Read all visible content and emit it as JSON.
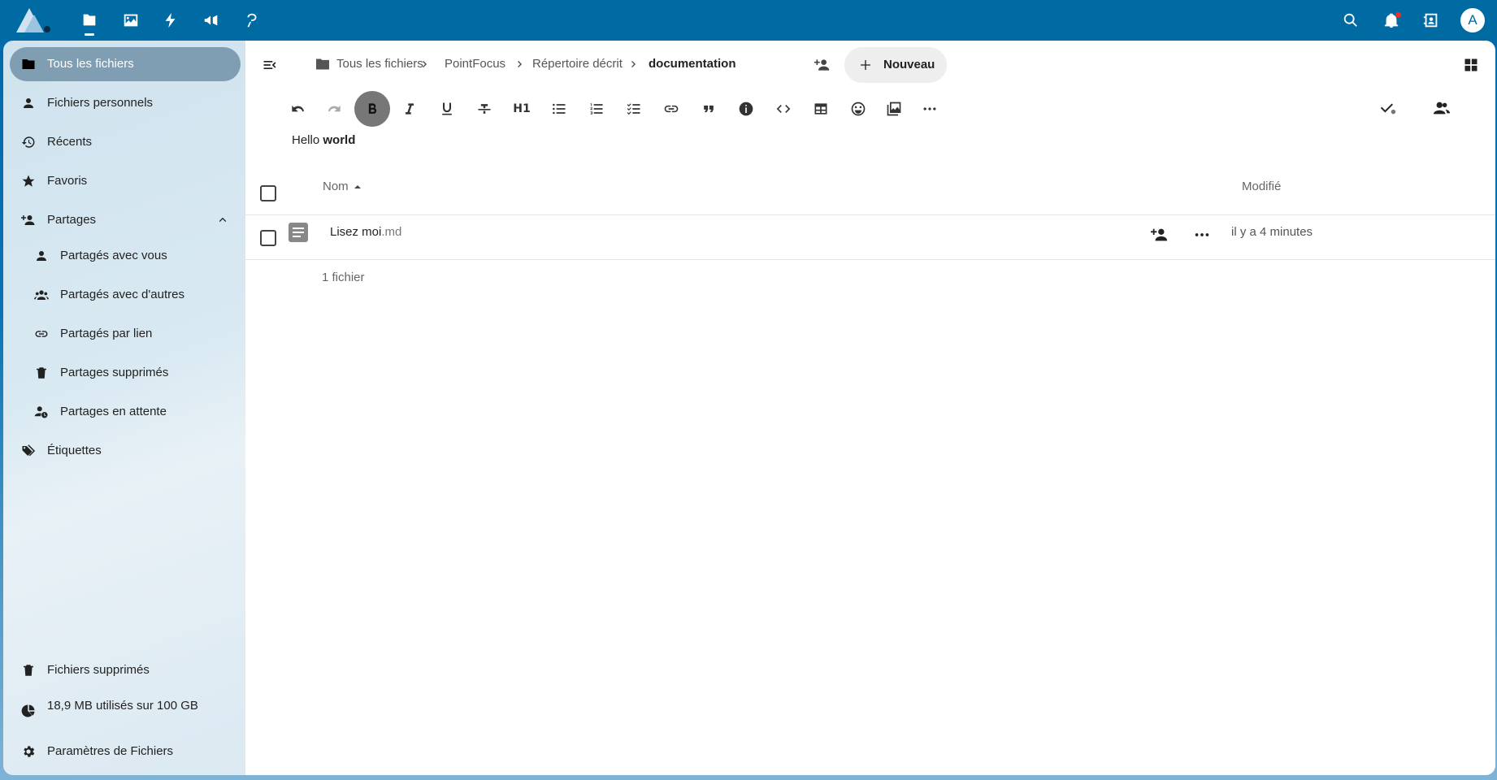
{
  "topbar": {
    "apps": [
      {
        "name": "files-icon"
      },
      {
        "name": "photos-icon"
      },
      {
        "name": "activity-icon"
      },
      {
        "name": "announcements-icon"
      },
      {
        "name": "talk-icon"
      }
    ],
    "avatar_letter": "A",
    "colors": {
      "bar": "#006aa3"
    }
  },
  "sidebar": {
    "items": [
      {
        "label": "Tous les fichiers",
        "icon": "folder-icon",
        "active": true
      },
      {
        "label": "Fichiers personnels",
        "icon": "account-icon"
      },
      {
        "label": "Récents",
        "icon": "history-icon"
      },
      {
        "label": "Favoris",
        "icon": "star-icon"
      },
      {
        "label": "Partages",
        "icon": "share-add-icon",
        "expanded": true
      },
      {
        "label": "Partagés avec vous",
        "icon": "account-icon"
      },
      {
        "label": "Partagés avec d'autres",
        "icon": "account-group-icon"
      },
      {
        "label": "Partagés par lien",
        "icon": "link-icon"
      },
      {
        "label": "Partages supprimés",
        "icon": "trash-icon"
      },
      {
        "label": "Partages en attente",
        "icon": "account-clock-icon"
      },
      {
        "label": "Étiquettes",
        "icon": "tag-icon"
      }
    ],
    "bottom": {
      "trash": "Fichiers supprimés",
      "quota": "18,9 MB utilisés sur 100 GB",
      "settings": "Paramètres de Fichiers"
    }
  },
  "breadcrumb": {
    "items": [
      "Tous les fichiers",
      "PointFocus",
      "Répertoire décrit",
      "documentation"
    ],
    "new_label": "Nouveau"
  },
  "editor": {
    "toolbar": [
      "undo",
      "redo",
      "bold",
      "italic",
      "underline",
      "strikethrough",
      "H1",
      "bulleted-list",
      "numbered-list",
      "checklist",
      "link",
      "blockquote",
      "info",
      "code",
      "table",
      "emoji",
      "image",
      "more"
    ],
    "heading_label": "H1",
    "text_plain": "Hello ",
    "text_bold": "world"
  },
  "filelist": {
    "col_name": "Nom",
    "col_modified": "Modifié",
    "rows": [
      {
        "base": "Lisez moi",
        "ext": ".md",
        "modified": "il y a 4 minutes"
      }
    ],
    "summary": "1 fichier"
  }
}
